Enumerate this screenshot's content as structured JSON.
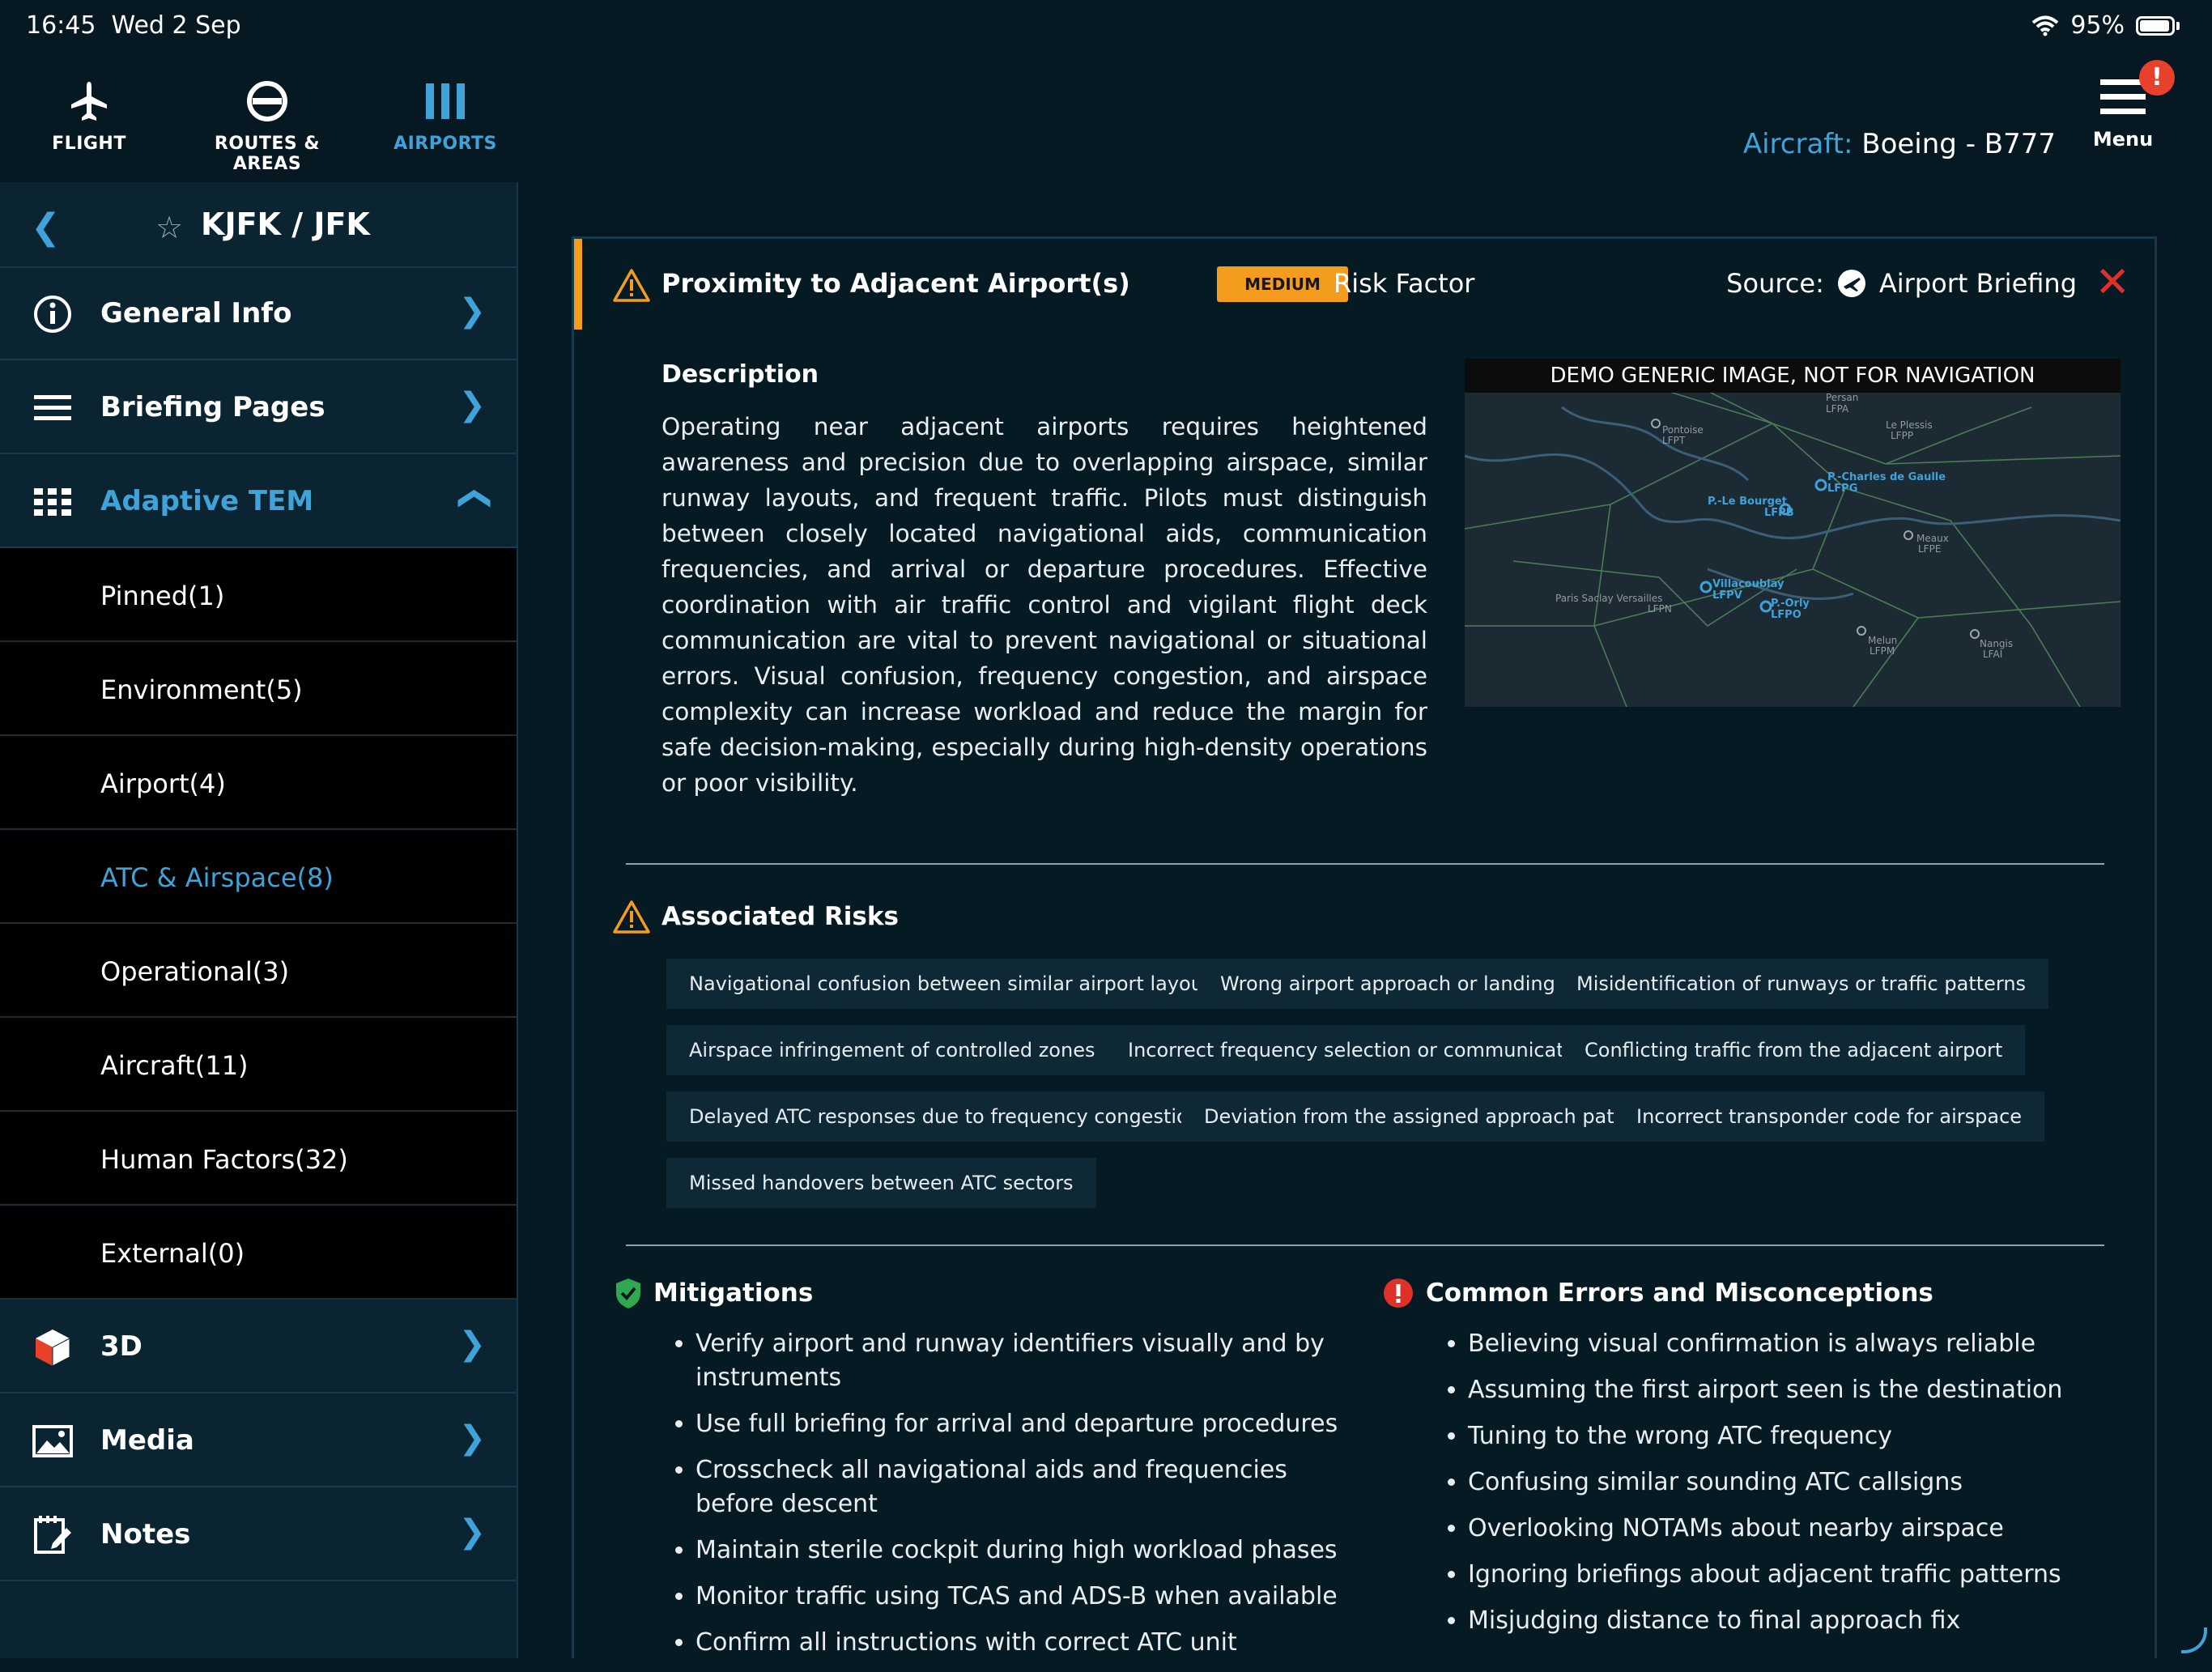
{
  "status_bar": {
    "time": "16:45",
    "date": "Wed 2 Sep",
    "battery": "95%"
  },
  "top_nav": {
    "items": [
      {
        "label": "FLIGHT",
        "icon": "airplane-icon",
        "active": false
      },
      {
        "label": "ROUTES & AREAS",
        "icon": "route-icon",
        "active": false
      },
      {
        "label": "AIRPORTS",
        "icon": "airports-icon",
        "active": true
      }
    ],
    "aircraft_label": "Aircraft:",
    "aircraft_value": "Boeing - B777",
    "menu_label": "Menu",
    "menu_badge": "!"
  },
  "sidebar": {
    "airport_code": "KJFK / JFK",
    "items": [
      {
        "label": "General Info",
        "icon": "info-icon"
      },
      {
        "label": "Briefing Pages",
        "icon": "list-icon"
      },
      {
        "label": "Adaptive TEM",
        "icon": "grid-icon",
        "expanded": true
      }
    ],
    "sub_items": [
      {
        "label": "Pinned(1)"
      },
      {
        "label": "Environment(5)"
      },
      {
        "label": "Airport(4)"
      },
      {
        "label": "ATC & Airspace(8)",
        "active": true
      },
      {
        "label": "Operational(3)"
      },
      {
        "label": "Aircraft(11)"
      },
      {
        "label": "Human Factors(32)"
      },
      {
        "label": "External(0)"
      }
    ],
    "bottom_items": [
      {
        "label": "3D",
        "icon": "cube-icon"
      },
      {
        "label": "Media",
        "icon": "image-icon"
      },
      {
        "label": "Notes",
        "icon": "notes-icon"
      }
    ]
  },
  "card": {
    "title": "Proximity to Adjacent Airport(s)",
    "severity": "MEDIUM",
    "risk_factor": "Risk Factor",
    "source_label": "Source:",
    "source_value": "Airport Briefing",
    "description_title": "Description",
    "description": "Operating near adjacent airports requires heightened awareness and precision due to overlapping airspace, similar runway layouts, and frequent traffic. Pilots must distinguish between closely located navigational aids, communication frequencies, and arrival or departure procedures. Effective coordination with air traffic control and vigilant flight deck communication are vital to prevent navigational or situational errors. Visual confusion, frequency congestion, and airspace complexity can increase workload and reduce the margin for safe decision-making, especially during high-density operations or poor visibility.",
    "map_banner": "DEMO GENERIC IMAGE, NOT FOR NAVIGATION",
    "map_labels": [
      {
        "name": "Persan",
        "code": "LFPA"
      },
      {
        "name": "Pontoise",
        "code": "LFPT"
      },
      {
        "name": "Le Plessis",
        "code": "LFPP"
      },
      {
        "name": "P.-Charles de Gaulle",
        "code": "LFPG"
      },
      {
        "name": "P.-Le Bourget",
        "code": "LFPB"
      },
      {
        "name": "Meaux",
        "code": "LFPE"
      },
      {
        "name": "Villacoublay",
        "code": "LFPV"
      },
      {
        "name": "Paris Saclay Versailles",
        "code": "LFPN"
      },
      {
        "name": "P.-Orly",
        "code": "LFPO"
      },
      {
        "name": "Melun",
        "code": "LFPM"
      },
      {
        "name": "Nangis",
        "code": "LFAI"
      }
    ],
    "associated_risks_title": "Associated Risks",
    "associated_risks": [
      "Navigational confusion between similar airport layouts",
      "Wrong airport approach or landing",
      "Misidentification of runways or traffic patterns",
      "Airspace infringement of controlled zones",
      "Incorrect frequency selection or communication",
      "Conflicting traffic from the adjacent airport",
      "Delayed ATC responses due to frequency congestion",
      "Deviation from the assigned approach path",
      "Incorrect transponder code for airspace",
      "Missed handovers between ATC sectors"
    ],
    "mitigations_title": "Mitigations",
    "mitigations": [
      "Verify airport and runway identifiers visually and by instruments",
      "Use full briefing for arrival and departure procedures",
      "Crosscheck all navigational aids and frequencies before descent",
      "Maintain sterile cockpit during high workload phases",
      "Monitor traffic using TCAS and ADS-B when available",
      "Confirm all instructions with correct ATC unit"
    ],
    "errors_title": "Common Errors and Misconceptions",
    "errors": [
      "Believing visual confirmation is always reliable",
      "Assuming the first airport seen is the destination",
      "Tuning to the wrong ATC frequency",
      "Confusing similar sounding ATC callsigns",
      "Overlooking NOTAMs about nearby airspace",
      "Ignoring briefings about adjacent traffic patterns",
      "Misjudging distance to final approach fix"
    ]
  },
  "colors": {
    "accent": "#3fa2d8",
    "warning": "#f39c1e",
    "danger": "#e0302a",
    "success": "#2fa84f",
    "background": "#061922"
  }
}
